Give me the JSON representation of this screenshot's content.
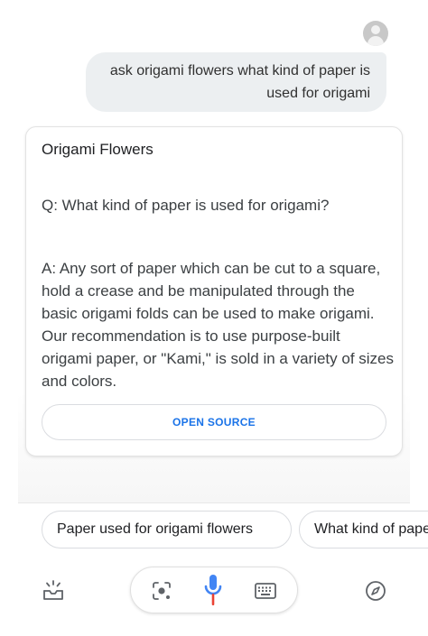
{
  "conversation": {
    "user_query": "ask origami flowers what kind of paper is used for origami"
  },
  "answer_card": {
    "title": "Origami Flowers",
    "question": "Q: What kind of paper is used for origami?",
    "answer": "A: Any sort of paper which can be cut to a square, hold a crease and be manipulated through the basic origami folds can be used to make origami. Our recommendation is to use purpose-built origami paper, or \"Kami,\" is sold in a variety of sizes and colors.",
    "open_source_label": "OPEN SOURCE"
  },
  "suggestions": [
    {
      "label": "Paper used for origami flowers"
    },
    {
      "label": "What kind of paper"
    }
  ],
  "toolbar": {
    "left_icon": "snapshot-inbox-icon",
    "center_icons": [
      "lens-icon",
      "mic-icon",
      "keyboard-icon"
    ],
    "right_icon": "explore-compass-icon"
  },
  "colors": {
    "accent_blue": "#1a73e8",
    "mic_blue": "#4285f4",
    "mic_red": "#ea4335",
    "bubble_bg": "#eceff1"
  }
}
